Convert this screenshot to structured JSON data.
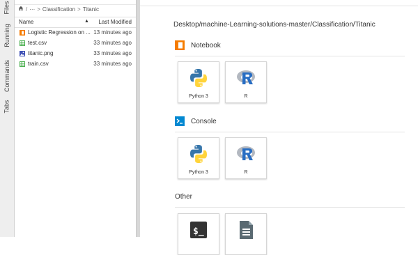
{
  "sidebar": {
    "tabs": [
      {
        "label": "Files"
      },
      {
        "label": "Running"
      },
      {
        "label": "Commands"
      },
      {
        "label": "Tabs"
      }
    ]
  },
  "filebrowser": {
    "breadcrumb": {
      "ellipsis": "···",
      "sep1": "/",
      "folder1": "Classification",
      "sep2": ">",
      "folder2": "Titanic"
    },
    "columns": {
      "name": "Name",
      "sort_indicator": "▲",
      "modified": "Last Modified"
    },
    "files": [
      {
        "name": "Logistic Regression on ...",
        "modified": "13 minutes ago",
        "icon": "notebook-icon",
        "color": "#f57c00"
      },
      {
        "name": "test.csv",
        "modified": "33 minutes ago",
        "icon": "spreadsheet-icon",
        "color": "#4caf50"
      },
      {
        "name": "titanic.png",
        "modified": "33 minutes ago",
        "icon": "image-icon",
        "color": "#3f51b5"
      },
      {
        "name": "train.csv",
        "modified": "33 minutes ago",
        "icon": "spreadsheet-icon",
        "color": "#4caf50"
      }
    ]
  },
  "launcher": {
    "cwd": "Desktop/machine-Learning-solutions-master/Classification/Titanic",
    "notebook": {
      "title": "Notebook",
      "kernels": [
        "Python 3",
        "R"
      ]
    },
    "console": {
      "title": "Console",
      "kernels": [
        "Python 3",
        "R"
      ]
    },
    "other": {
      "title": "Other"
    }
  },
  "colors": {
    "notebook_accent": "#f57c00",
    "console_accent": "#0288d1",
    "python_blue": "#3776ab",
    "python_yellow": "#ffd43b",
    "r_blue": "#276dc3"
  }
}
